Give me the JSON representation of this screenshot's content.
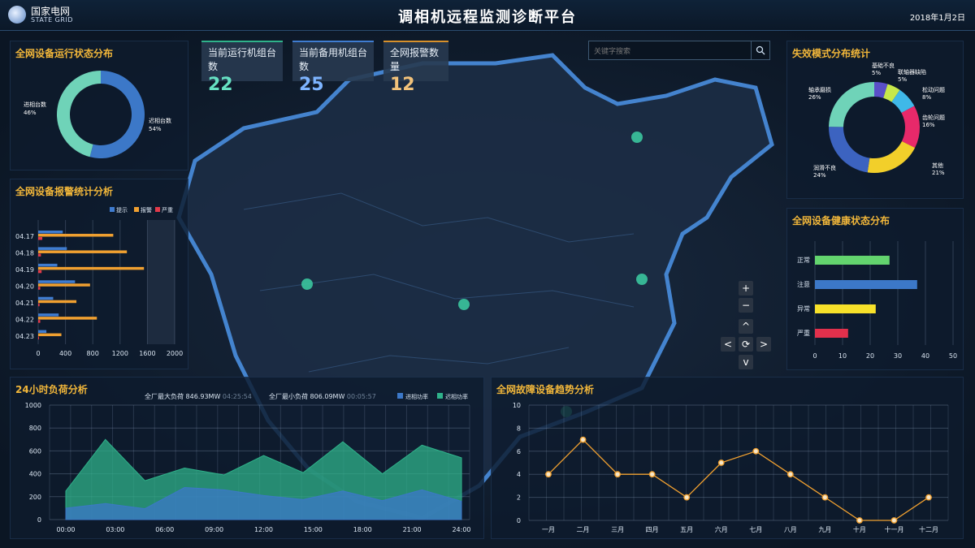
{
  "header": {
    "logo_cn": "国家电网",
    "logo_en": "STATE GRID",
    "title": "调相机远程监测诊断平台",
    "date": "2018年1月2日"
  },
  "stats": [
    {
      "label": "当前运行机组台数",
      "value": "22",
      "color": "#66e0c2",
      "accent": "#2fb28a"
    },
    {
      "label": "当前备用机组台数",
      "value": "25",
      "color": "#7db4ff",
      "accent": "#3f7cd0"
    },
    {
      "label": "全网报警数量",
      "value": "12",
      "color": "#f2c27a",
      "accent": "#d7902b"
    }
  ],
  "search": {
    "placeholder": "关键字搜索"
  },
  "map_controls": {
    "zoom_in": "+",
    "zoom_out": "−",
    "up": "^",
    "left": "<",
    "reset": "⟳",
    "right": ">",
    "down": "v"
  },
  "status_panel": {
    "title": "全网设备运行状态分布",
    "chart_data": {
      "type": "pie",
      "slices": [
        {
          "label": "进相台数",
          "pct": "46%",
          "value": 46,
          "color": "#6fd3b8"
        },
        {
          "label": "迟相台数",
          "pct": "54%",
          "value": 54,
          "color": "#3c78c8"
        }
      ]
    }
  },
  "alarm_panel": {
    "title": "全网设备报警统计分析",
    "chart_data": {
      "type": "bar",
      "categories": [
        "04.17",
        "04.18",
        "04.19",
        "04.20",
        "04.21",
        "04.22",
        "04.23"
      ],
      "series": [
        {
          "name": "提示",
          "color": "#3f7cd0",
          "values": [
            360,
            420,
            280,
            540,
            220,
            300,
            120
          ]
        },
        {
          "name": "报警",
          "color": "#f0a030",
          "values": [
            1100,
            1300,
            1550,
            760,
            560,
            860,
            340
          ]
        },
        {
          "name": "严重",
          "color": "#e23a4a",
          "values": [
            60,
            40,
            50,
            30,
            20,
            30,
            10
          ]
        }
      ],
      "xticks": [
        "0",
        "400",
        "800",
        "1200",
        "1600",
        "2000"
      ],
      "xlim": [
        0,
        2000
      ]
    }
  },
  "failure_panel": {
    "title": "失效模式分布统计",
    "chart_data": {
      "type": "pie",
      "slices": [
        {
          "label": "基础不良",
          "pct": "5%",
          "value": 5,
          "color": "#5a4fc7"
        },
        {
          "label": "联轴器缺陷",
          "pct": "5%",
          "value": 5,
          "color": "#c7e84a"
        },
        {
          "label": "松动问题",
          "pct": "8%",
          "value": 8,
          "color": "#3fb8e8"
        },
        {
          "label": "齿轮问题",
          "pct": "16%",
          "value": 16,
          "color": "#e8296a"
        },
        {
          "label": "其他",
          "pct": "21%",
          "value": 21,
          "color": "#f2cf2a"
        },
        {
          "label": "润滑不良",
          "pct": "24%",
          "value": 24,
          "color": "#3c63c0"
        },
        {
          "label": "轴承磨损",
          "pct": "26%",
          "value": 26,
          "color": "#6fd3b8"
        }
      ]
    }
  },
  "health_panel": {
    "title": "全网设备健康状态分布",
    "chart_data": {
      "type": "bar",
      "categories": [
        "正常",
        "注意",
        "异常",
        "严重"
      ],
      "values": [
        27,
        37,
        22,
        12
      ],
      "colors": [
        "#63d46e",
        "#3c78c8",
        "#f7e12a",
        "#e2304c"
      ],
      "xticks": [
        "0",
        "10",
        "20",
        "30",
        "40",
        "50"
      ],
      "xlim": [
        0,
        50
      ]
    }
  },
  "load_panel": {
    "title": "24小时负荷分析",
    "max_label": "全厂最大负荷",
    "max_value": "846.93MW",
    "max_time": "04:25:54",
    "min_label": "全厂最小负荷",
    "min_value": "806.09MW",
    "min_time": "00:05:57",
    "chart_data": {
      "type": "area",
      "x": [
        "00:00",
        "03:00",
        "06:00",
        "09:00",
        "12:00",
        "15:00",
        "18:00",
        "21:00",
        "24:00"
      ],
      "ylim": [
        0,
        1000
      ],
      "yticks": [
        "0",
        "200",
        "400",
        "600",
        "800",
        "1000"
      ],
      "series": [
        {
          "name": "迟相功率",
          "color": "#2fb28a",
          "values": [
            250,
            700,
            340,
            450,
            390,
            560,
            410,
            680,
            400,
            650,
            540
          ]
        },
        {
          "name": "进相功率",
          "color": "#3c78c8",
          "values": [
            100,
            140,
            95,
            280,
            260,
            210,
            175,
            250,
            165,
            260,
            160
          ]
        }
      ]
    }
  },
  "trend_panel": {
    "title": "全网故障设备趋势分析",
    "chart_data": {
      "type": "line",
      "categories": [
        "一月",
        "二月",
        "三月",
        "四月",
        "五月",
        "六月",
        "七月",
        "八月",
        "九月",
        "十月",
        "十一月",
        "十二月"
      ],
      "values": [
        4,
        7,
        4,
        4,
        2,
        5,
        6,
        4,
        2,
        0,
        0,
        2
      ],
      "ylim": [
        0,
        10
      ],
      "yticks": [
        "0",
        "2",
        "4",
        "6",
        "8",
        "10"
      ],
      "color": "#f0a030"
    }
  }
}
